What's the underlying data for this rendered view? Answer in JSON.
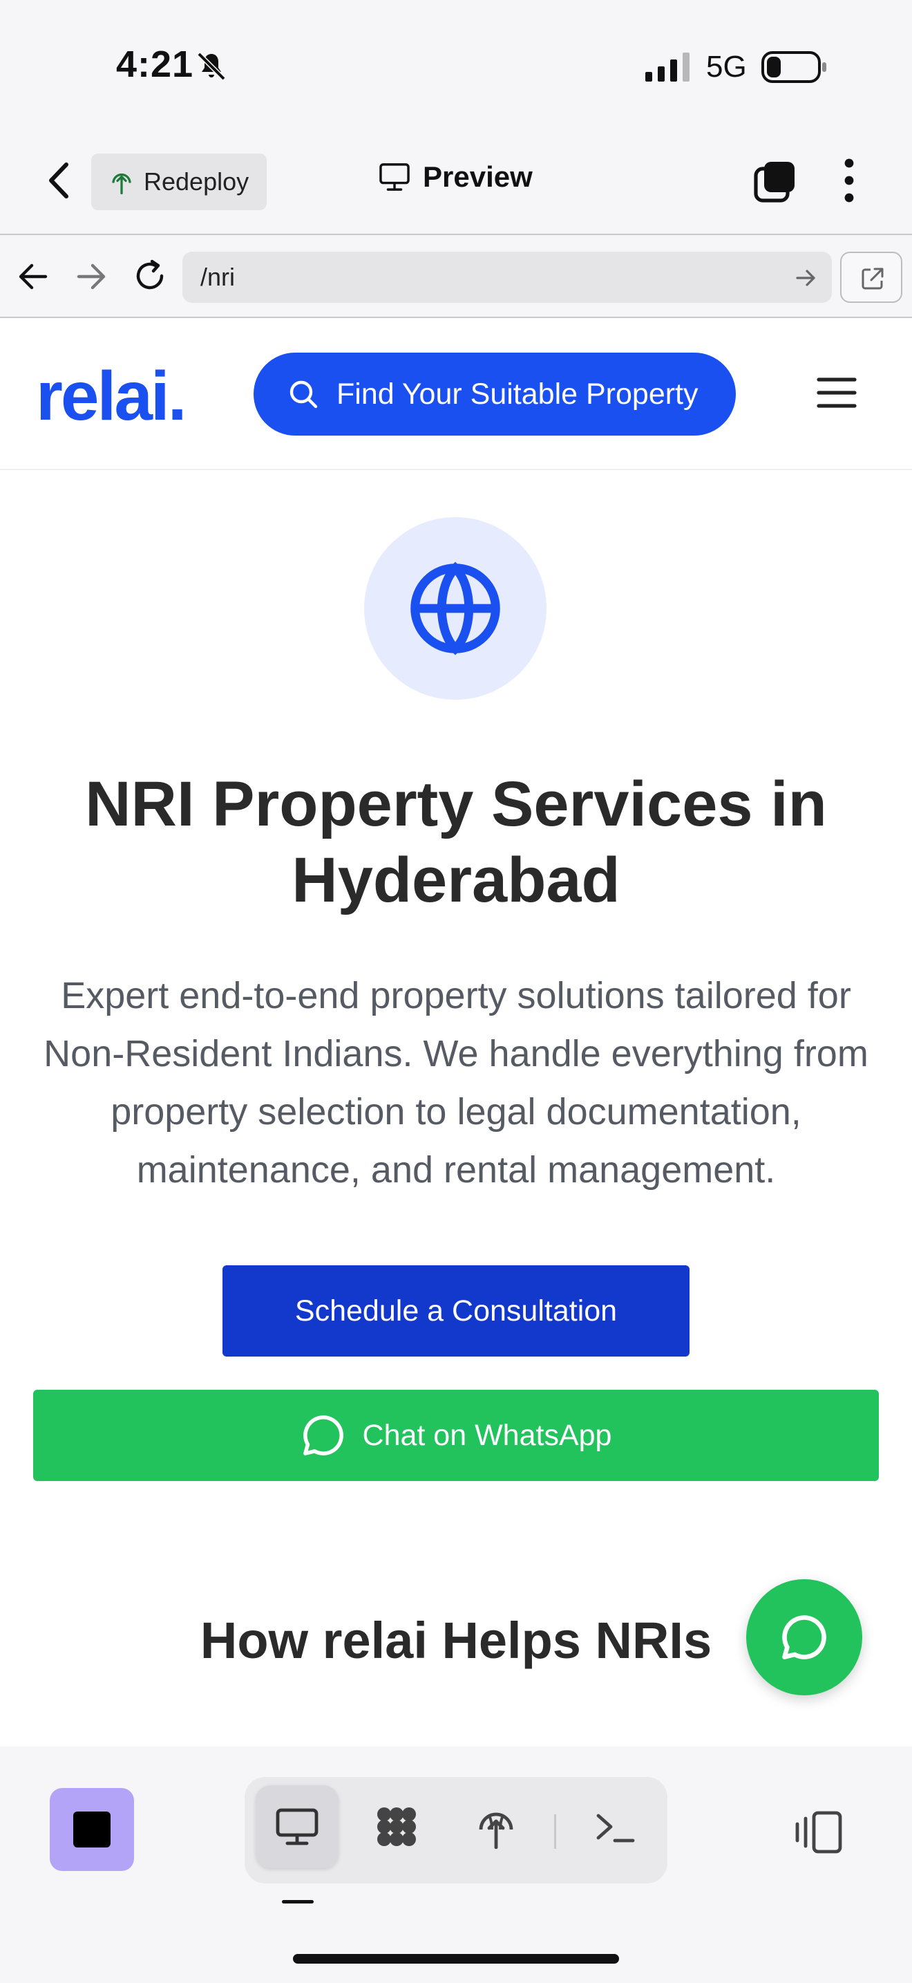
{
  "status_bar": {
    "time": "4:21",
    "network": "5G"
  },
  "toolbar": {
    "redeploy_label": "Redeploy",
    "preview_label": "Preview"
  },
  "url_bar": {
    "url": "/nri"
  },
  "site": {
    "logo": "relai.",
    "search_button_label": "Find Your Suitable Property",
    "hero_title": "NRI Property Services in Hyderabad",
    "hero_description": "Expert end-to-end property solutions tailored for Non-Resident Indians. We handle everything from property selection to legal documentation, maintenance, and rental management.",
    "schedule_button": "Schedule a Consultation",
    "whatsapp_button": "Chat on WhatsApp",
    "section_title": "How relai Helps NRIs"
  },
  "colors": {
    "brand_blue": "#1a4ff0",
    "schedule_blue": "#1338cc",
    "whatsapp_green": "#22c25d",
    "stop_purple": "#b3a4f7"
  },
  "icons": [
    "back-icon",
    "redeploy-icon",
    "monitor-icon",
    "tabs-icon",
    "more-icon",
    "arrow-left-icon",
    "arrow-right-icon",
    "reload-icon",
    "external-link-icon",
    "search-icon",
    "hamburger-icon",
    "globe-icon",
    "chat-bubble-icon",
    "stop-icon",
    "desktop-icon",
    "apps-icon",
    "deploy-icon",
    "terminal-icon",
    "panel-toggle-icon"
  ]
}
